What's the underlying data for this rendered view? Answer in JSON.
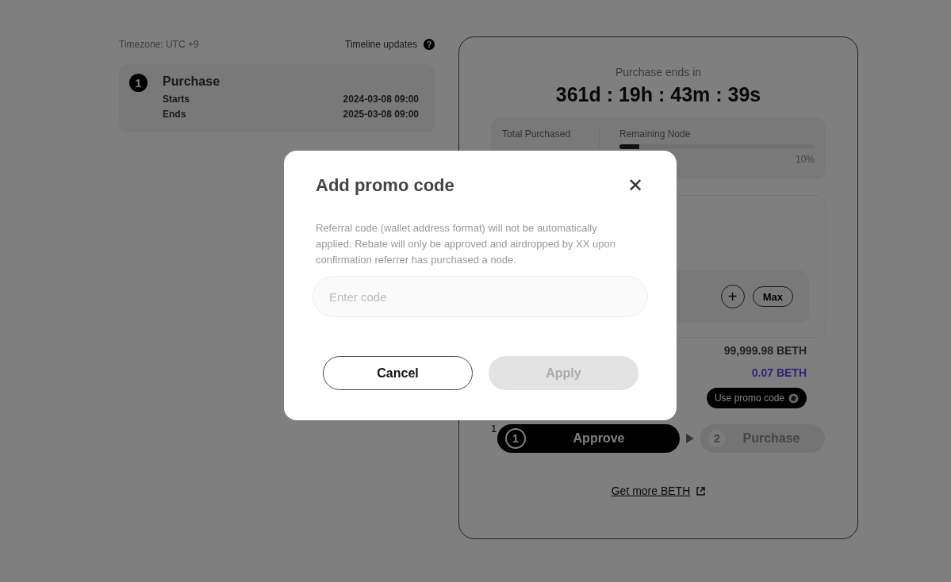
{
  "timeline": {
    "timezone": "Timezone: UTC +9",
    "updates_label": "Timeline updates",
    "help_icon": "?",
    "phases": [
      {
        "number": "1",
        "title": "Purchase",
        "rows": [
          {
            "label": "Starts",
            "value": "2024-03-08 09:00"
          },
          {
            "label": "Ends",
            "value": "2025-03-08 09:00"
          }
        ]
      }
    ]
  },
  "purchase_card": {
    "countdown_label": "Purchase ends in",
    "countdown": "361d : 19h : 43m : 39s",
    "stats": {
      "total_label": "Total Purchased",
      "remaining_label": "Remaining Node",
      "level": 0.1,
      "remaining_percent": "10%"
    },
    "plus_button": "+",
    "max_button": "Max",
    "balance": "99,999.98 BETH",
    "price": "0.07 BETH",
    "promo_button": "Use promo code",
    "step_note": "1",
    "steps": [
      {
        "number": "1",
        "label": "Approve",
        "active": true
      },
      {
        "number": "2",
        "label": "Purchase",
        "active": false
      }
    ],
    "link": "Get more BETH"
  },
  "modal": {
    "title": "Add promo code",
    "close": "✕",
    "description": "Referral code (wallet address format) will not be automatically applied. Rebate will only be approved and airdropped by XX upon confirmation referrer has purchased a node.",
    "input": {
      "placeholder": "Enter code"
    },
    "buttons": [
      {
        "label": "Cancel",
        "kind": "secondary",
        "disabled": false
      },
      {
        "label": "Apply",
        "kind": "primary",
        "disabled": true
      }
    ]
  }
}
